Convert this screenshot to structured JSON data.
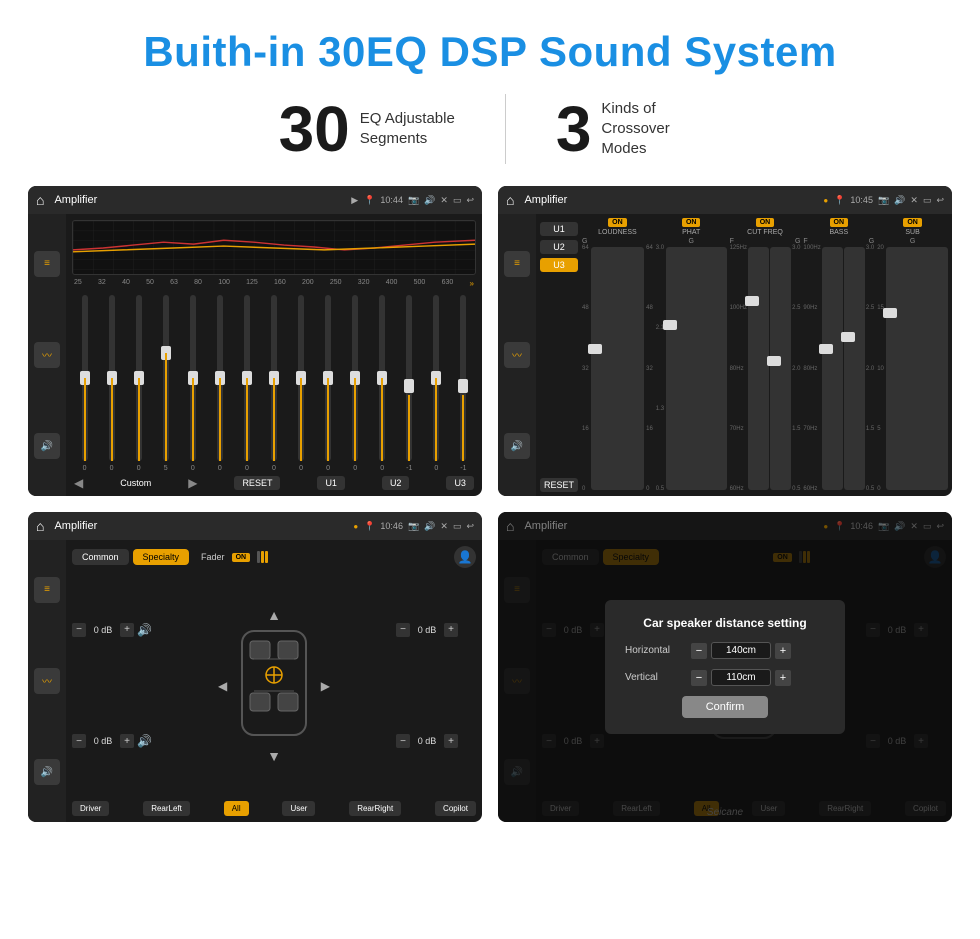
{
  "page": {
    "title": "Buith-in 30EQ DSP Sound System"
  },
  "stats": {
    "eq_number": "30",
    "eq_label": "EQ Adjustable\nSegments",
    "crossover_number": "3",
    "crossover_label": "Kinds of\nCrossover Modes"
  },
  "screen1": {
    "title": "Amplifier",
    "time": "10:44",
    "frequencies": [
      "25",
      "32",
      "40",
      "50",
      "63",
      "80",
      "100",
      "125",
      "160",
      "200",
      "250",
      "320",
      "400",
      "500",
      "630"
    ],
    "values": [
      "0",
      "0",
      "0",
      "5",
      "0",
      "0",
      "0",
      "0",
      "0",
      "0",
      "0",
      "0",
      "-1",
      "0",
      "-1"
    ],
    "presets": [
      "Custom",
      "RESET",
      "U1",
      "U2",
      "U3"
    ],
    "preset_label": "Custom"
  },
  "screen2": {
    "title": "Amplifier",
    "time": "10:45",
    "channels": [
      "LOUDNESS",
      "PHAT",
      "CUT FREQ",
      "BASS",
      "SUB"
    ],
    "channel_states": [
      "ON",
      "ON",
      "ON",
      "ON",
      "ON"
    ],
    "presets": [
      "U1",
      "U2",
      "U3"
    ],
    "active_preset": "U3",
    "reset_label": "RESET"
  },
  "screen3": {
    "title": "Amplifier",
    "time": "10:46",
    "tabs": [
      "Common",
      "Specialty"
    ],
    "active_tab": "Specialty",
    "fader_label": "Fader",
    "fader_on": "ON",
    "bottom_buttons": [
      "Driver",
      "RearLeft",
      "All",
      "User",
      "RearRight",
      "Copilot"
    ],
    "active_bottom": "All",
    "db_values": [
      "0 dB",
      "0 dB",
      "0 dB",
      "0 dB"
    ]
  },
  "screen4": {
    "title": "Amplifier",
    "time": "10:46",
    "tabs": [
      "Common",
      "Specialty"
    ],
    "active_tab": "Specialty",
    "fader_on": "ON",
    "dialog": {
      "title": "Car speaker distance setting",
      "horizontal_label": "Horizontal",
      "horizontal_value": "140cm",
      "vertical_label": "Vertical",
      "vertical_value": "110cm",
      "confirm_label": "Confirm"
    },
    "bottom_buttons": [
      "Driver",
      "RearLeft",
      "All",
      "User",
      "RearRight",
      "Copilot"
    ],
    "db_values": [
      "0 dB",
      "0 dB"
    ],
    "watermark": "Seicane"
  }
}
